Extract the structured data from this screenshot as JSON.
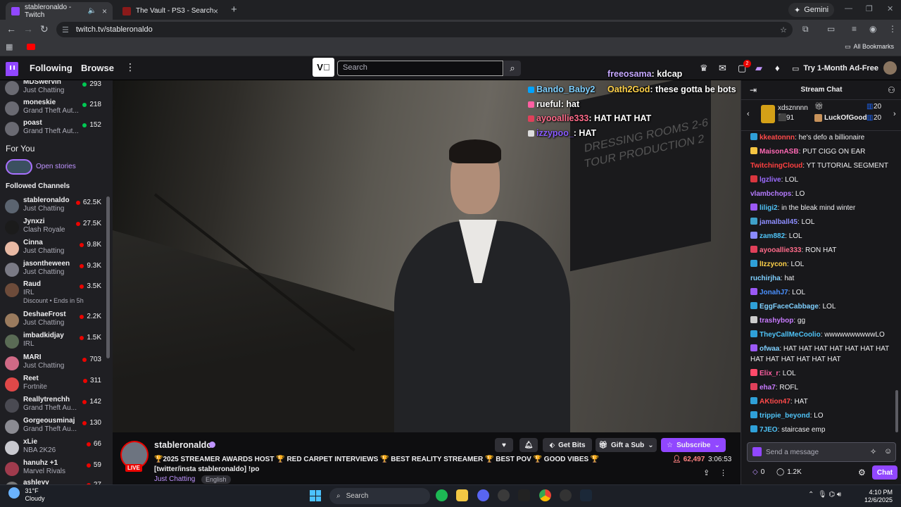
{
  "browser": {
    "tabs": [
      {
        "title": "stableronaldo - Twitch",
        "active": true
      },
      {
        "title": "The Vault - PS3 - Search Results",
        "active": false
      }
    ],
    "gemini_label": "Gemini",
    "url": "twitch.tv/stableronaldo",
    "all_bookmarks": "All Bookmarks"
  },
  "twitch_nav": {
    "following": "Following",
    "browse": "Browse",
    "search_placeholder": "Search",
    "notification_count": "2",
    "ad_free": "Try 1-Month Ad-Free"
  },
  "sidebar": {
    "top_channels": [
      {
        "name": "MDSwervin",
        "game": "Just Chatting",
        "viewers": "293",
        "dot": "#00c853"
      },
      {
        "name": "moneskie",
        "game": "Grand Theft Aut...",
        "viewers": "218",
        "dot": "#00c853"
      },
      {
        "name": "poast",
        "game": "Grand Theft Aut...",
        "viewers": "152",
        "dot": "#00c853"
      }
    ],
    "for_you": "For You",
    "open_stories": "Open stories",
    "followed_title": "Followed Channels",
    "followed": [
      {
        "name": "stableronaldo",
        "game": "Just Chatting",
        "viewers": "62.5K",
        "av": "#5b6470"
      },
      {
        "name": "Jynxzi",
        "game": "Clash Royale",
        "viewers": "27.5K",
        "av": "#1b1b1b"
      },
      {
        "name": "Cinna",
        "game": "Just Chatting",
        "viewers": "9.8K",
        "av": "#e8b9a4"
      },
      {
        "name": "jasontheween",
        "game": "Just Chatting",
        "viewers": "9.3K",
        "av": "#7a7a85"
      },
      {
        "name": "Raud",
        "game": "IRL",
        "viewers": "3.5K",
        "av": "#6d4b3a",
        "extra": "Discount • Ends in 5h"
      },
      {
        "name": "DeshaeFrost",
        "game": "Just Chatting",
        "viewers": "2.2K",
        "av": "#9a7b5e"
      },
      {
        "name": "imbadkidjay",
        "game": "IRL",
        "viewers": "1.5K",
        "av": "#5a6b55"
      },
      {
        "name": "MARI",
        "game": "Just Chatting",
        "viewers": "703",
        "av": "#d06a86"
      },
      {
        "name": "Reet",
        "game": "Fortnite",
        "viewers": "311",
        "av": "#e04848"
      },
      {
        "name": "Reallytrenchh",
        "game": "Grand Theft Au...",
        "viewers": "142",
        "av": "#4a4a52"
      },
      {
        "name": "Gorgeousminaj",
        "game": "Grand Theft Au...",
        "viewers": "130",
        "av": "#8b8b92"
      },
      {
        "name": "xLie",
        "game": "NBA 2K26",
        "viewers": "66",
        "av": "#c9c9cf"
      },
      {
        "name": "hanuhz +1",
        "game": "Marvel Rivals",
        "viewers": "59",
        "av": "#a03b4d"
      },
      {
        "name": "ashleyy",
        "game": "",
        "viewers": "27",
        "av": "#777"
      }
    ]
  },
  "video_overlay": {
    "header_msg": {
      "user": "freeosama",
      "text": ": kdcap"
    },
    "lines": [
      {
        "user": "Bando_Baby2",
        "text": "",
        "color": "#7fd0ff",
        "badge": "#00a3ff"
      },
      {
        "user": "Oath2God",
        "text": ": these gotta be bots",
        "color": "#ffd24a",
        "badge": ""
      },
      {
        "user": "rueful",
        "text": ": hat",
        "color": "#ffffff",
        "badge": "#ff5fa2"
      },
      {
        "user": "ayooallie333",
        "text": ": HAT HAT HAT",
        "color": "#ff6b8a",
        "badge": "#e0405a"
      },
      {
        "user": "izzypoo_",
        "text": ": HAT",
        "color": "#8a5cff",
        "badge": "#dddddd"
      }
    ],
    "sign_text": "DRESSING ROOMS 2-6\nTOUR PRODUCTION 2"
  },
  "stream": {
    "channel": "stableronaldo",
    "live": "LIVE",
    "title": "🏆2025 STREAMER AWARDS HOST 🏆 RED CARPET INTERVIEWS 🏆 BEST REALITY STREAMER 🏆 BEST POV 🏆 GOOD VIBES 🏆 [twitter/insta stableronaldo] !po",
    "category": "Just Chatting",
    "language": "English",
    "get_bits": "Get Bits",
    "gift_sub": "Gift a Sub",
    "subscribe": "Subscribe",
    "viewers": "62,497",
    "uptime": "3:06:53"
  },
  "chat": {
    "header": "Stream Chat",
    "gifts": {
      "user1": "xdsznnnn",
      "user1_count": "91",
      "count2": "20",
      "user3": "LuckOfGood",
      "user3_count": "20"
    },
    "messages": [
      {
        "user": "kkeatonnn",
        "text": ": he's defo a billionaire",
        "color": "#ff4a4a",
        "badge": "#2fa0d8"
      },
      {
        "user": "MaisonASB",
        "text": ": PUT CIGG ON EAR",
        "color": "#ff69b4",
        "badge": "#f5c542"
      },
      {
        "user": "TwitchingCloud",
        "text": ": YT TUTORIAL SEGMENT",
        "color": "#ff4040",
        "badge": ""
      },
      {
        "user": "lgzlive",
        "text": ": LOL",
        "color": "#9b6bff",
        "badge": "#d9363e"
      },
      {
        "user": "vlambchops",
        "text": ": LO",
        "color": "#b57bff",
        "badge": ""
      },
      {
        "user": "liligi2",
        "text": ": in the bleak mind winter",
        "color": "#4fc3f7",
        "badge": "#9b59f5"
      },
      {
        "user": "jamalball45",
        "text": ": LOL",
        "color": "#8e8eff",
        "badge": "#3fa0c8"
      },
      {
        "user": "zam882",
        "text": ": LOL",
        "color": "#4fc3f7",
        "badge": "#8a8aff"
      },
      {
        "user": "ayooallie333",
        "text": ": RON HAT",
        "color": "#ff6b8a",
        "badge": "#e0405a"
      },
      {
        "user": "lIzzycon",
        "text": ": LOL",
        "color": "#ffd24a",
        "badge": "#2fa0d8"
      },
      {
        "user": "ruchirjha",
        "text": ": hat",
        "color": "#7fd0ff",
        "badge": ""
      },
      {
        "user": "JonahJ7",
        "text": ": LOL",
        "color": "#4a90ff",
        "badge": "#9b59f5"
      },
      {
        "user": "EggFaceCabbage",
        "text": ": LOL",
        "color": "#7fd0ff",
        "badge": "#2fa0d8"
      },
      {
        "user": "trashybop",
        "text": ": gg",
        "color": "#c87bff",
        "badge": "#cccccc"
      },
      {
        "user": "TheyCallMeCoolio",
        "text": ": wwwwwwwwwwLO",
        "color": "#4fc3f7",
        "badge": "#2fa0d8"
      },
      {
        "user": "ofwaa",
        "text": ": HAT HAT HAT HAT HAT HAT HAT HAT HAT HAT HAT HAT HAT",
        "color": "#7fd0ff",
        "badge": "#9b59f5"
      },
      {
        "user": "Elix_r",
        "text": ": LOL",
        "color": "#ff5fa2",
        "badge": "#ff4a6a"
      },
      {
        "user": "eha7",
        "text": ": ROFL",
        "color": "#c87bff",
        "badge": "#e0405a"
      },
      {
        "user": "AKtion47",
        "text": ": HAT",
        "color": "#ff4a4a",
        "badge": "#2fa0d8"
      },
      {
        "user": "trippie_beyond",
        "text": ": LO",
        "color": "#4fc3f7",
        "badge": "#2fa0d8"
      },
      {
        "user": "7JEO",
        "text": ": staircase emp",
        "color": "#4fc3f7",
        "badge": "#2fa0d8"
      }
    ],
    "send_placeholder": "Send a message",
    "points": "0",
    "points2": "1.2K",
    "chat_button": "Chat"
  },
  "taskbar": {
    "temp": "31°F",
    "condition": "Cloudy",
    "search": "Search",
    "time": "4:10 PM",
    "date": "12/6/2025"
  }
}
